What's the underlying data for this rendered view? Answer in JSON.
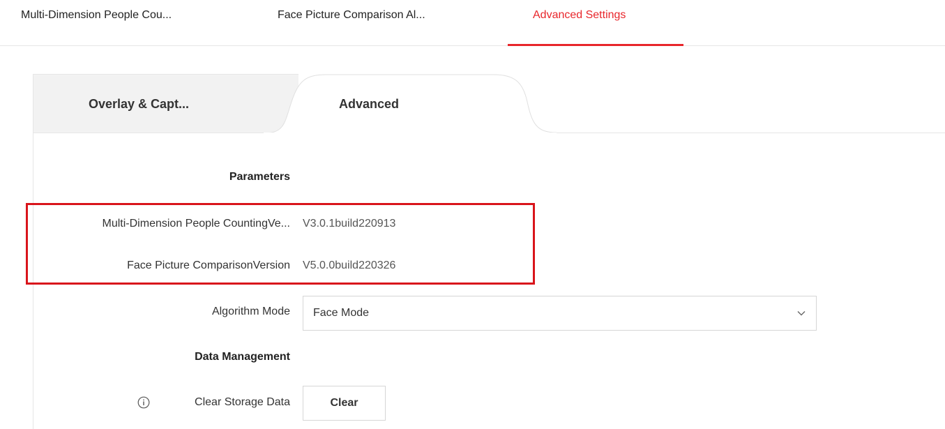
{
  "top_tabs": [
    {
      "label": "Multi-Dimension People Cou..."
    },
    {
      "label": "Face Picture Comparison Al..."
    },
    {
      "label": "Advanced Settings"
    }
  ],
  "sub_tabs": [
    {
      "label": "Overlay & Capt..."
    },
    {
      "label": "Advanced"
    }
  ],
  "parameters": {
    "title": "Parameters",
    "people_counting_version_label": "Multi-Dimension People CountingVe...",
    "people_counting_version_value": "V3.0.1build220913",
    "face_comparison_version_label": "Face Picture ComparisonVersion",
    "face_comparison_version_value": "V5.0.0build220326",
    "algorithm_mode_label": "Algorithm Mode",
    "algorithm_mode_value": "Face Mode"
  },
  "data_management": {
    "title": "Data Management",
    "clear_storage_label": "Clear Storage Data",
    "clear_button_label": "Clear"
  },
  "colors": {
    "accent": "#e8262b",
    "highlight_box": "#d9141b"
  },
  "icons": {
    "select_chevron": "chevron-down-icon",
    "info": "info-icon"
  }
}
